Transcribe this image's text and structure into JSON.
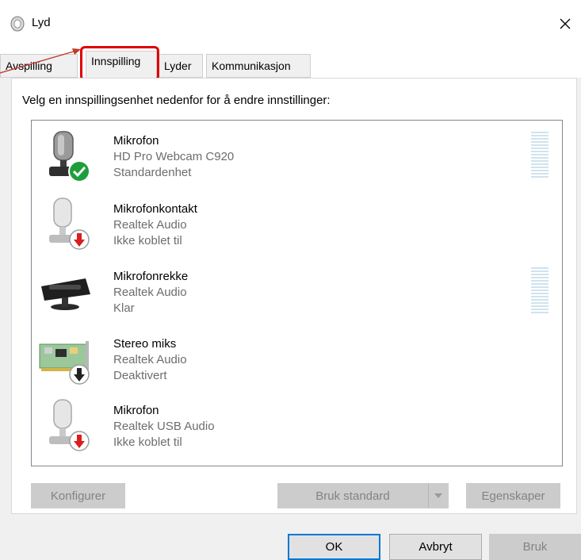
{
  "window": {
    "title": "Lyd"
  },
  "tabs": [
    {
      "label": "Avspilling"
    },
    {
      "label": "Innspilling",
      "active": true
    },
    {
      "label": "Lyder"
    },
    {
      "label": "Kommunikasjon"
    }
  ],
  "instruction": "Velg en innspillingsenhet nedenfor for å endre innstillinger:",
  "devices": [
    {
      "name": "Mikrofon",
      "description": "HD Pro Webcam C920",
      "status": "Standardenhet",
      "icon": "webcam-mic-icon",
      "badge": "default-check-icon",
      "meter": true
    },
    {
      "name": "Mikrofonkontakt",
      "description": "Realtek Audio",
      "status": "Ikke koblet til",
      "icon": "microphone-icon",
      "badge": "disconnected-arrow-icon",
      "meter": false
    },
    {
      "name": "Mikrofonrekke",
      "description": "Realtek Audio",
      "status": "Klar",
      "icon": "mic-array-icon",
      "badge": "",
      "meter": true
    },
    {
      "name": "Stereo miks",
      "description": "Realtek Audio",
      "status": "Deaktivert",
      "icon": "sound-card-icon",
      "badge": "disabled-arrow-icon",
      "meter": false
    },
    {
      "name": "Mikrofon",
      "description": "Realtek USB Audio",
      "status": "Ikke koblet til",
      "icon": "microphone-icon",
      "badge": "disconnected-arrow-icon",
      "meter": false
    }
  ],
  "buttons": {
    "configure": "Konfigurer",
    "set_default": "Bruk standard",
    "properties": "Egenskaper",
    "ok": "OK",
    "cancel": "Avbryt",
    "apply": "Bruk"
  },
  "colors": {
    "highlight": "#e00000",
    "accent": "#0078d7",
    "check_green": "#1e9e3a",
    "disconnected_red": "#d81e1e"
  }
}
